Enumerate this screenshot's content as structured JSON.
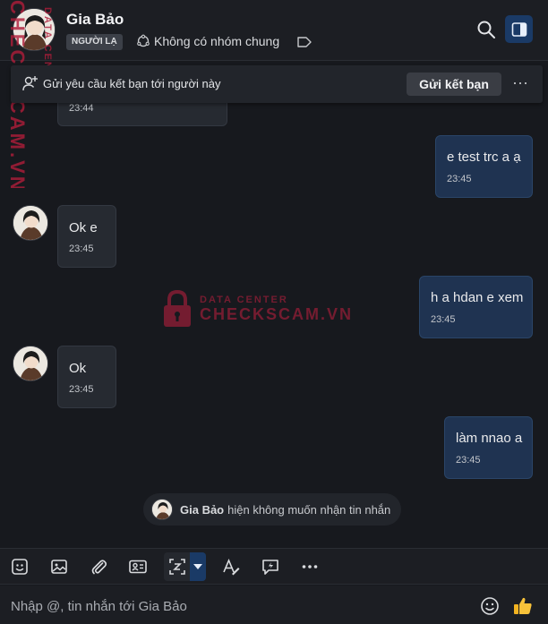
{
  "header": {
    "name": "Gia Bảo",
    "badge": "NGƯỜI LẠ",
    "group_info": "Không có nhóm chung"
  },
  "friend_request": {
    "text": "Gửi yêu cầu kết bạn tới người này",
    "button": "Gửi kết bạn",
    "more": "···"
  },
  "messages": [
    {
      "side": "in",
      "text": "",
      "time": "23:44"
    },
    {
      "side": "out",
      "text": "e test trc a ạ",
      "time": "23:45"
    },
    {
      "side": "in",
      "text": "Ok e",
      "time": "23:45"
    },
    {
      "side": "out",
      "text": "h a hdan e xem",
      "time": "23:45"
    },
    {
      "side": "in",
      "text": "Ok",
      "time": "23:45"
    },
    {
      "side": "out",
      "text": "làm nnao a",
      "time": "23:45"
    }
  ],
  "status": {
    "name": "Gia Bảo",
    "text": "hiện không muốn nhận tin nhắn"
  },
  "composer": {
    "placeholder": "Nhập @, tin nhắn tới Gia Bảo"
  },
  "watermark": {
    "side_top": "DATA CENTER",
    "side_main": "CHECKSCAM.VN",
    "center_top": "DATA CENTER",
    "center_main": "CHECKSCAM.VN"
  },
  "colors": {
    "background": "#17191e",
    "incoming_bubble": "#262a31",
    "outgoing_bubble": "#1f3351",
    "accent": "#1a3a66",
    "watermark": "#c0203f"
  }
}
